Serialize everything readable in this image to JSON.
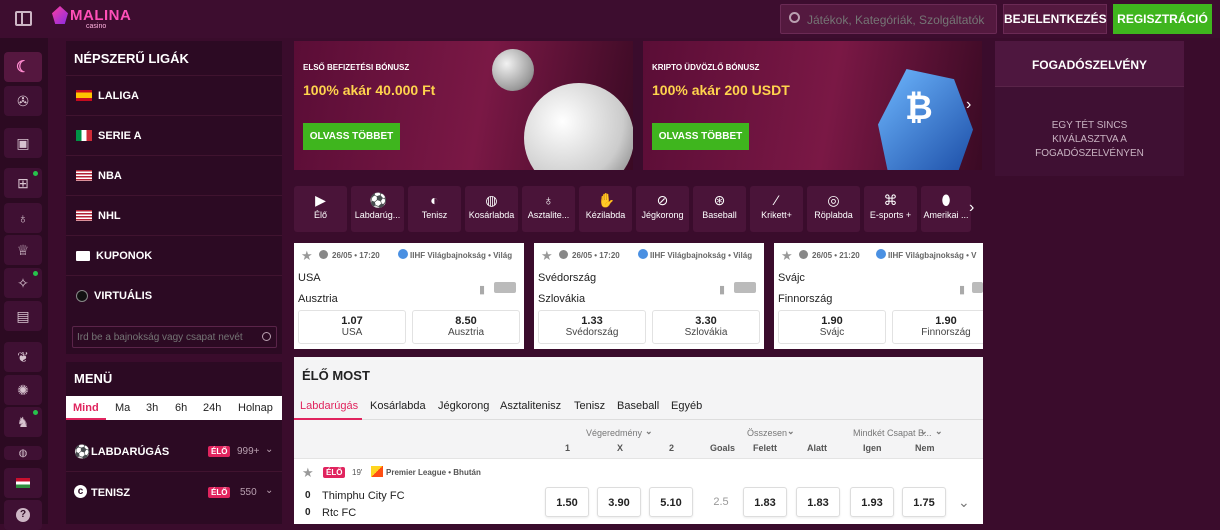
{
  "brand": {
    "logo_main": "MALINA",
    "logo_sub": "casino"
  },
  "header": {
    "search_placeholder": "Játékok, Kategóriák, Szolgáltatók",
    "login": "BEJELENTKEZÉS",
    "register": "REGISZTRÁCIÓ"
  },
  "leagues": {
    "title": "NÉPSZERŰ LIGÁK",
    "items": [
      "LALIGA",
      "SERIE A",
      "NBA",
      "NHL",
      "KUPONOK",
      "VIRTUÁLIS"
    ],
    "search_placeholder": "Ird be a bajnokság vagy csapat nevét"
  },
  "menu": {
    "title": "MENÜ",
    "filters": [
      "Mind",
      "Ma",
      "3h",
      "6h",
      "24h",
      "Holnap"
    ],
    "sports": [
      {
        "name": "LABDARÚGÁS",
        "badge": "ÉLŐ",
        "count": "999+"
      },
      {
        "name": "TENISZ",
        "badge": "ÉLŐ",
        "count": "550"
      }
    ]
  },
  "banners": [
    {
      "kicker": "ELSŐ BEFIZETÉSI BÓNUSZ",
      "headline": "100% akár 40.000 Ft",
      "cta": "OLVASS TÖBBET"
    },
    {
      "kicker": "KRIPTO ÜDVÖZLŐ BÓNUSZ",
      "headline": "100% akár 200 USDT",
      "cta": "OLVASS TÖBBET"
    }
  ],
  "betslip": {
    "title": "FOGADÓSZELVÉNY",
    "empty": "EGY TÉT SINCS KIVÁLASZTVA A FOGADÓSZELVÉNYEN"
  },
  "sports_bar": [
    "Élő",
    "Labdarúg...",
    "Tenisz",
    "Kosárlabda",
    "Asztalite...",
    "Kézilabda",
    "Jégkorong",
    "Baseball",
    "Krikett+",
    "Röplabda",
    "E-sports +",
    "Amerikai ..."
  ],
  "matches": [
    {
      "time": "26/05 • 17:20",
      "league": "IIHF Világbajnokság • Világ",
      "team1": "USA",
      "team2": "Ausztria",
      "odd1": "1.07",
      "odd2": "8.50"
    },
    {
      "time": "26/05 • 17:20",
      "league": "IIHF Világbajnokság • Világ",
      "team1": "Svédország",
      "team2": "Szlovákia",
      "odd1": "1.33",
      "odd2": "3.30"
    },
    {
      "time": "26/05 • 21:20",
      "league": "IIHF Világbajnokság • V",
      "team1": "Svájc",
      "team2": "Finnország",
      "odd1": "1.90",
      "odd2": "1.90"
    }
  ],
  "live": {
    "title": "ÉLŐ MOST",
    "tabs": [
      "Labdarúgás",
      "Kosárlabda",
      "Jégkorong",
      "Asztalitenisz",
      "Tenisz",
      "Baseball",
      "Egyéb"
    ],
    "groups": [
      "Végeredmény",
      "Összesen",
      "Mindkét Csapat B..."
    ],
    "cols": [
      "1",
      "X",
      "2",
      "Goals",
      "Felett",
      "Alatt",
      "Igen",
      "Nem"
    ],
    "event": {
      "badge": "ÉLŐ",
      "minute": "19'",
      "league": "Premier League • Bhután",
      "score1": "0",
      "score2": "0",
      "team1": "Thimphu City FC",
      "team2": "Rtc FC",
      "odds": [
        "1.50",
        "3.90",
        "5.10",
        "2.5",
        "1.83",
        "1.83",
        "1.93",
        "1.75"
      ]
    }
  },
  "colors": {
    "bg": "#3a0c2c",
    "panel": "#2c0a23",
    "accent": "#e0245e",
    "green": "#3fb51e"
  }
}
